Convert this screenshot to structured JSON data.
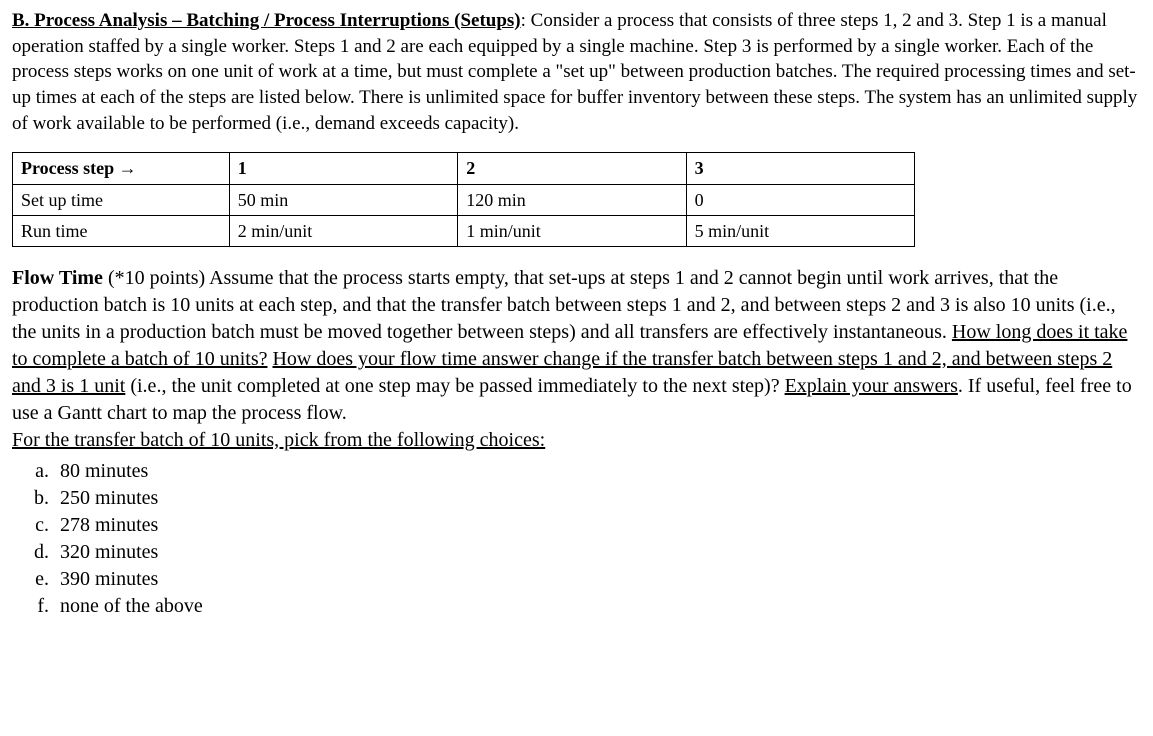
{
  "intro": {
    "title_prefix": "B. Process Analysis – Batching / Process Interruptions (Setups)",
    "title_suffix": ": ",
    "body": "Consider a process that consists of three steps 1, 2 and 3. Step 1 is a manual operation staffed by a single worker. Steps 1 and 2 are each equipped by a single machine. Step 3 is performed by a single worker. Each of the process steps works on one unit of work at a time, but must complete a \"set up\" between production batches.  The required processing times and set-up times at each of the steps are listed below. There is unlimited space for buffer inventory between these steps.  The system has an unlimited supply of work available to be performed (i.e., demand exceeds capacity)."
  },
  "table": {
    "header_label": "Process step",
    "arrow": "→",
    "cols": [
      "1",
      "2",
      "3"
    ],
    "rows": [
      {
        "label": "Set up time",
        "cells": [
          "50 min",
          "120 min",
          "0"
        ]
      },
      {
        "label": "Run time",
        "cells": [
          "2 min/unit",
          "1 min/unit",
          "5 min/unit"
        ]
      }
    ]
  },
  "flow": {
    "title": "Flow Time",
    "points": " (*10 points) ",
    "body1": "Assume that the process starts empty, that set-ups at steps 1 and 2 cannot begin until work arrives, that the production batch is 10 units at each step, and that the transfer batch between steps 1 and 2, and between steps 2 and 3 is also 10 units (i.e., the units in a production batch must be moved together between steps) and all transfers are effectively instantaneous. ",
    "q1": "How long does it take to complete a batch of 10 units?",
    "sep1": " ",
    "q2": "How does your flow time answer change if the transfer batch between steps 1 and 2, and between steps 2 and 3 is 1 unit",
    "body2": " (i.e., the unit completed at one step may be passed immediately to the next step)? ",
    "q3": "Explain your answers",
    "body3": ". If useful, feel free to use a Gantt chart to map the process flow.",
    "choices_intro": "For the transfer batch of 10 units, pick from the following choices:"
  },
  "choices": [
    "80 minutes",
    "250 minutes",
    "278 minutes",
    "320 minutes",
    "390 minutes",
    "none of the above"
  ]
}
